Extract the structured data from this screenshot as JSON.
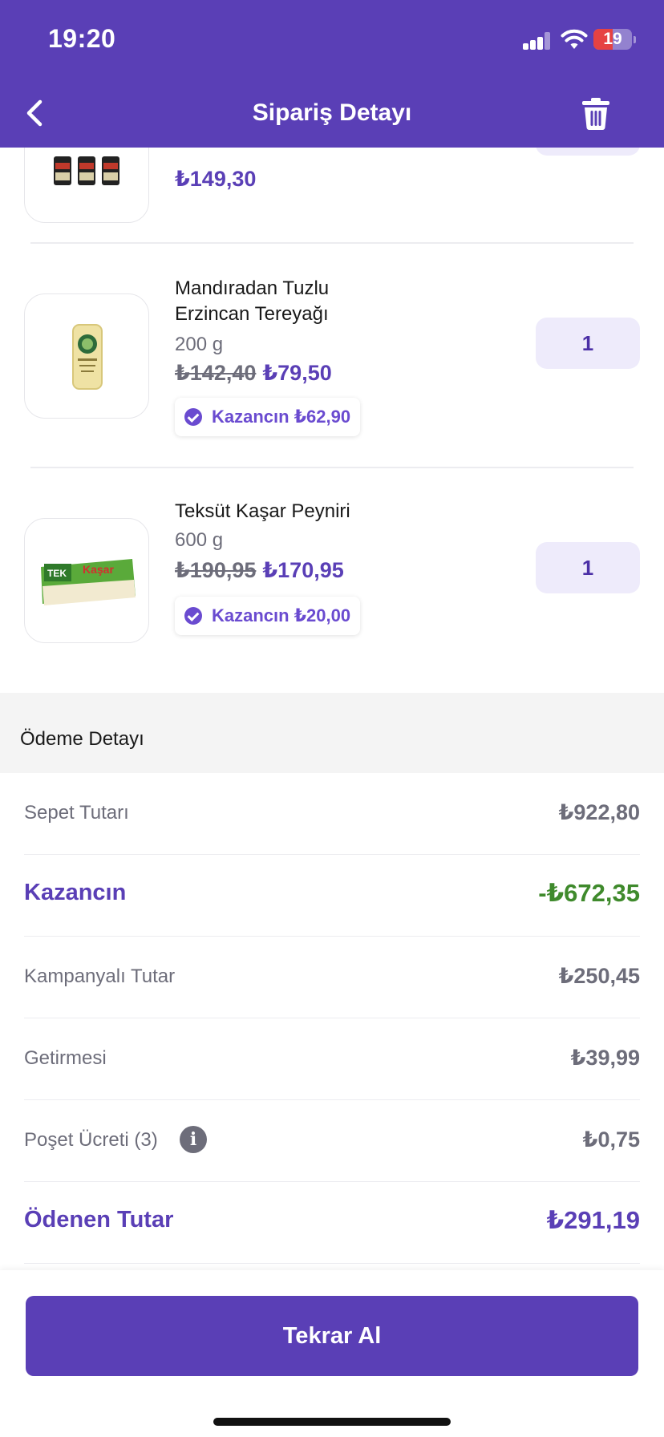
{
  "status_bar": {
    "time": "19:20",
    "battery_level": "19",
    "battery_color": "#e64242"
  },
  "header": {
    "title": "Sipariş Detayı",
    "back_icon": "chevron-left-icon",
    "delete_icon": "trash-icon"
  },
  "theme": {
    "primary": "#5a3fb6",
    "saving_green": "#3f8a2c",
    "muted": "#6d6d7a",
    "qty_bg": "#eeebfb"
  },
  "products": [
    {
      "price": "₺149,30"
    },
    {
      "name_line1": "Mandıradan Tuzlu",
      "name_line2": "Erzincan Tereyağı",
      "weight": "200 g",
      "old_price": "₺142,40",
      "price": "₺79,50",
      "savings": "Kazancın ₺62,90",
      "quantity": "1"
    },
    {
      "name": "Teksüt Kaşar Peyniri",
      "weight": "600 g",
      "old_price": "₺190,95",
      "price": "₺170,95",
      "savings": "Kazancın ₺20,00",
      "quantity": "1"
    }
  ],
  "payment": {
    "title": "Ödeme Detayı",
    "rows": [
      {
        "label": "Sepet Tutarı",
        "value": "₺922,80"
      },
      {
        "label": "Kazancın",
        "value": "-₺672,35"
      },
      {
        "label": "Kampanyalı Tutar",
        "value": "₺250,45"
      },
      {
        "label": "Getirmesi",
        "value": "₺39,99"
      },
      {
        "label": "Poşet Ücreti (3)",
        "value": "₺0,75"
      },
      {
        "label": "Ödenen Tutar",
        "value": "₺291,19"
      }
    ]
  },
  "footer": {
    "reorder_label": "Tekrar Al"
  }
}
